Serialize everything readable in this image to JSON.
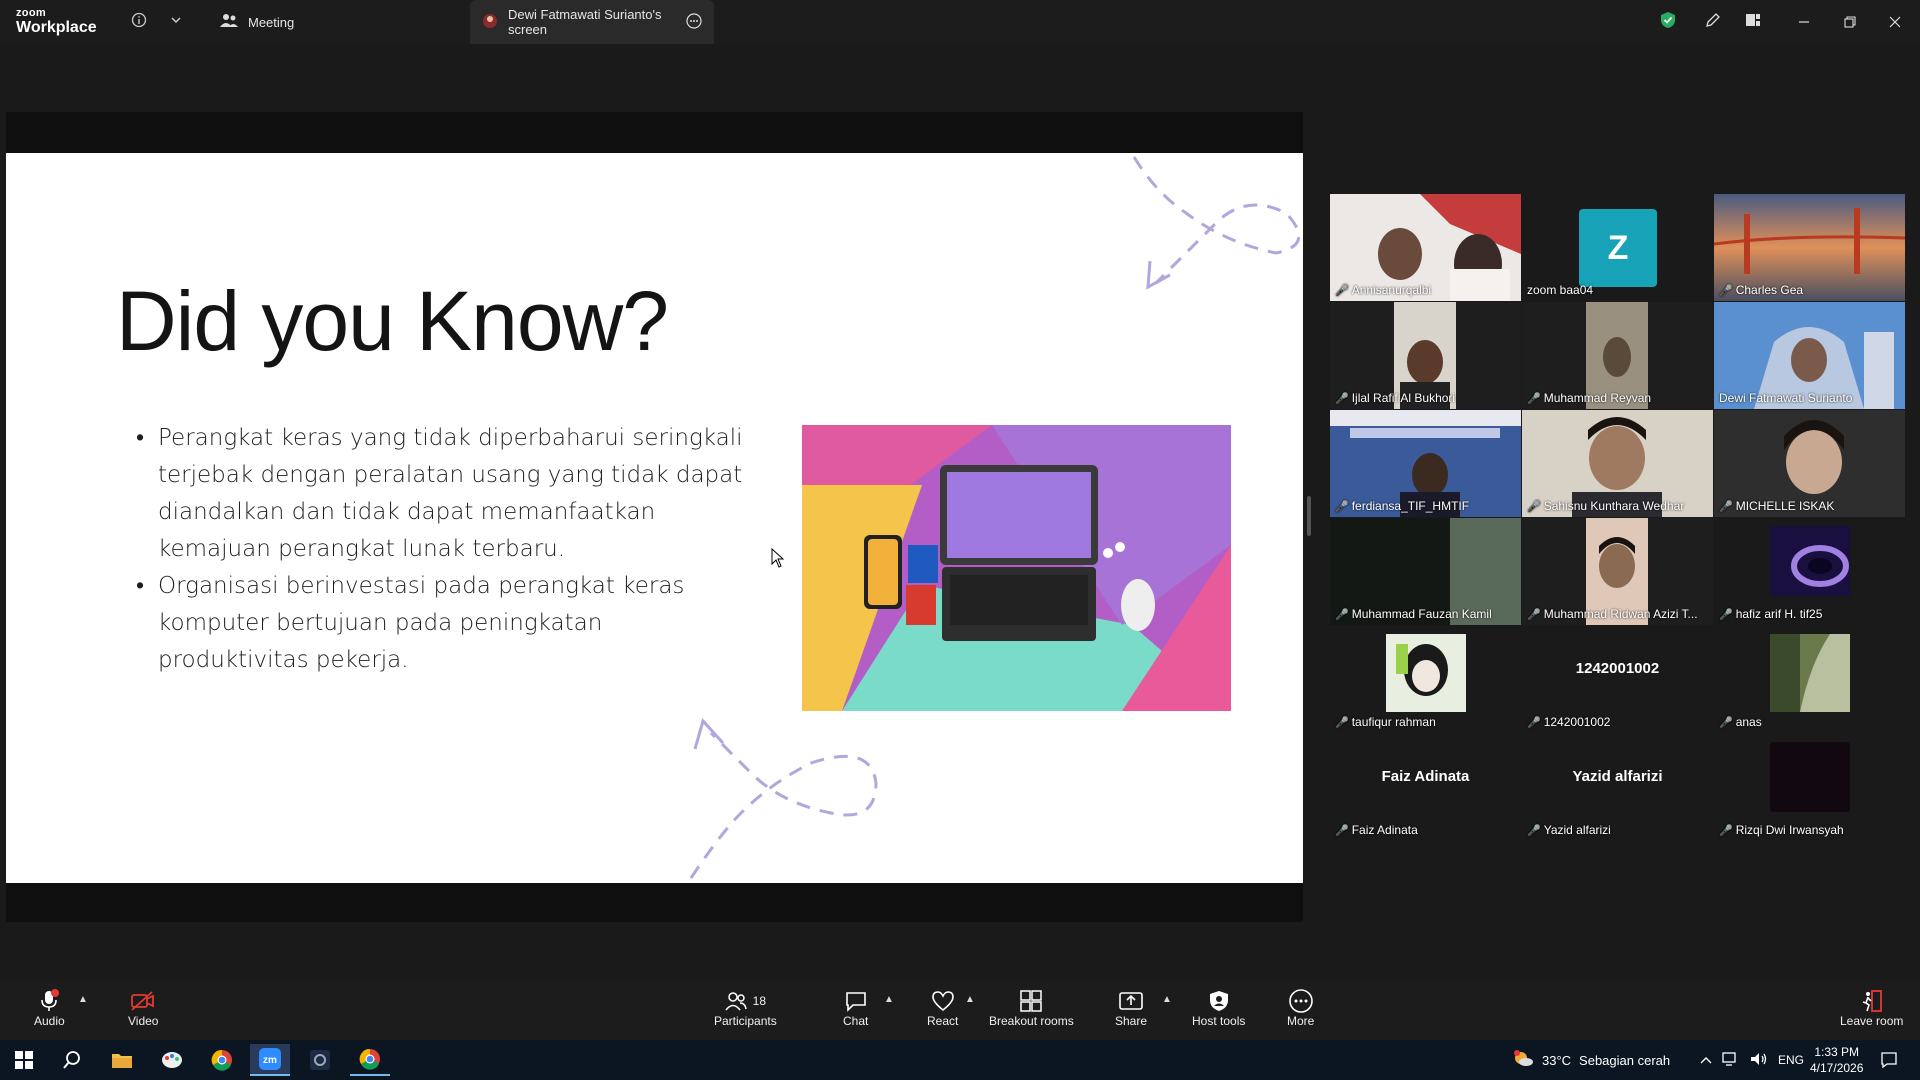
{
  "titlebar": {
    "brand_top": "zoom",
    "brand_bottom": "Workplace",
    "tab_meeting": "Meeting",
    "tab_share": "Dewi Fatmawati Surianto's screen"
  },
  "slide": {
    "title": "Did you Know?",
    "bullets": [
      "Perangkat keras yang tidak diperbaharui seringkali terjebak dengan peralatan usang yang tidak dapat diandalkan dan tidak dapat memanfaatkan kemajuan perangkat lunak terbaru.",
      "Organisasi berinvestasi pada perangkat keras komputer bertujuan pada peningkatan produktivitas pekerja."
    ]
  },
  "participants": [
    {
      "name": "Annisanurqalbi",
      "type": "video",
      "color": "#a04040"
    },
    {
      "name": "zoom baa04",
      "type": "avatar",
      "initial": "Z",
      "color": "#17a2b8"
    },
    {
      "name": "Charles Gea",
      "type": "photo",
      "color": "#c0603a"
    },
    {
      "name": "Ijlal Rafif Al Bukhori",
      "type": "video",
      "color": "#2a2a2a"
    },
    {
      "name": "Muhammad Reyvan",
      "type": "video",
      "color": "#3a3530"
    },
    {
      "name": "Dewi Fatmawati Surianto",
      "type": "video",
      "color": "#4a7fb8",
      "speaking": true
    },
    {
      "name": "ferdiansa_TIF_HMTIF",
      "type": "video",
      "color": "#405a9a"
    },
    {
      "name": "Sahisnu Kunthara Wedhar",
      "type": "video",
      "color": "#c8c0b0"
    },
    {
      "name": "MICHELLE ISKAK",
      "type": "video",
      "color": "#3a3a3a"
    },
    {
      "name": "Muhammad Fauzan Kamil",
      "type": "video",
      "color": "#1a1e1a"
    },
    {
      "name": "Muhammad Ridwan Azizi T...",
      "type": "video",
      "color": "#8a7a6a"
    },
    {
      "name": "hafiz arif H. tif25",
      "type": "photo",
      "color": "#2a2050"
    },
    {
      "name": "taufiqur rahman",
      "type": "photo",
      "color": "#7a8a6a"
    },
    {
      "name": "1242001002",
      "type": "text",
      "label": "1242001002"
    },
    {
      "name": "anas",
      "type": "photo",
      "color": "#7a8a5a"
    },
    {
      "name": "Faiz Adinata",
      "type": "text",
      "label": "Faiz Adinata"
    },
    {
      "name": "Yazid alfarizi",
      "type": "text",
      "label": "Yazid alfarizi"
    },
    {
      "name": "Rizqi Dwi Irwansyah",
      "type": "photo",
      "color": "#120810"
    }
  ],
  "toolbar": {
    "audio": "Audio",
    "video": "Video",
    "participants": "Participants",
    "participants_count": "18",
    "chat": "Chat",
    "react": "React",
    "breakout": "Breakout rooms",
    "share": "Share",
    "host_tools": "Host tools",
    "more": "More",
    "leave": "Leave room"
  },
  "taskbar": {
    "weather_temp": "33°C",
    "weather_desc": "Sebagian cerah",
    "lang": "ENG",
    "time": "1:33 PM",
    "date": "4/17/2026"
  },
  "colors": {
    "accent_green": "#2ecc71",
    "mute_red": "#e53935",
    "slide_deco": "#b3a6dd"
  }
}
